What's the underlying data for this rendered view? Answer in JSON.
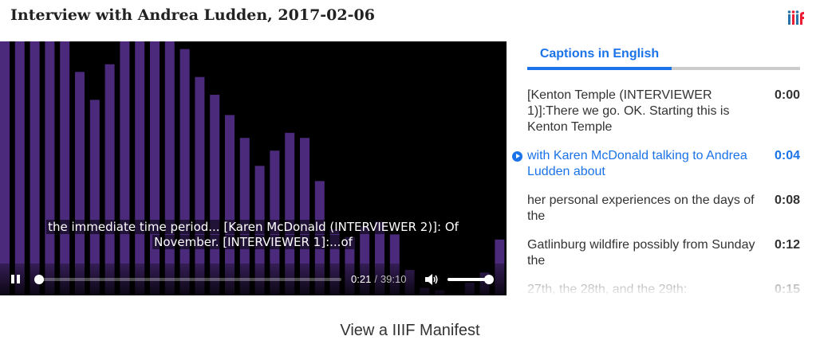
{
  "page": {
    "title": "Interview with Andrea Ludden, 2017-02-06",
    "logo_icon": "iiif-logo-icon"
  },
  "player": {
    "captions": [
      "the immediate time period... [Karen McDonald (INTERVIEWER 2)]: Of",
      "November. [INTERVIEWER 1]:...of"
    ],
    "current_time": "0:21",
    "separator": "/",
    "duration": "39:10",
    "progress_fraction": 0.009,
    "volume_fraction": 1.0,
    "play_state_icon": "pause-icon",
    "volume_icon": "volume-icon",
    "visualizer_color": "#4b2a7b",
    "visualizer_levels": [
      1.0,
      1.0,
      1.0,
      1.0,
      1.0,
      0.88,
      0.77,
      0.91,
      1.0,
      1.0,
      1.0,
      1.0,
      0.97,
      0.86,
      0.79,
      0.71,
      0.62,
      0.51,
      0.57,
      0.64,
      0.62,
      0.45,
      0.26,
      0.23,
      0.27,
      0.29,
      0.24,
      0.1,
      0.03,
      0.02,
      0.0,
      0.05,
      0.09,
      0.22
    ]
  },
  "tabs": [
    {
      "label": "Captions in English",
      "active": true
    }
  ],
  "transcript": [
    {
      "text": "[Kenton Temple (INTERVIEWER 1)]:There we go. OK. Starting this is Kenton Temple",
      "time": "0:00",
      "active": false
    },
    {
      "text": "with Karen McDonald talking to Andrea Ludden about",
      "time": "0:04",
      "active": true
    },
    {
      "text": "her personal experiences on the days of the",
      "time": "0:08",
      "active": false
    },
    {
      "text": "Gatlinburg wildfire possibly from Sunday the",
      "time": "0:12",
      "active": false
    },
    {
      "text": "27th, the 28th, and the 29th:",
      "time": "0:15",
      "active": false
    }
  ],
  "footer": {
    "manifest_label": "View a IIIF Manifest"
  },
  "colors": {
    "accent": "#1a73e8",
    "text": "#333333"
  }
}
